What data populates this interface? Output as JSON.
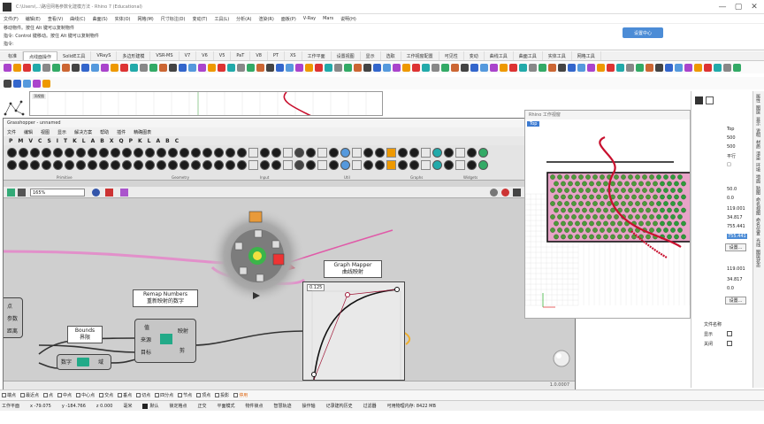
{
  "window": {
    "title": "C:\\Users\\...\\路径网格参数化建模方法 - Rhino 7 (Educational)",
    "controls": [
      "—",
      "▢",
      "✕"
    ]
  },
  "menu": [
    "文件(F)",
    "编辑(E)",
    "查看(V)",
    "曲线(C)",
    "曲面(S)",
    "实体(O)",
    "网格(M)",
    "尺寸标注(D)",
    "变动(T)",
    "工具(L)",
    "分析(A)",
    "渲染(R)",
    "面板(P)",
    "V-Ray",
    "Mars",
    "说明(H)"
  ],
  "command": {
    "line1": "移动物件。按住 Alt 键可以复制物件",
    "line2": "指令: Control 键移动。按住 Alt 键可以复制物件",
    "line3": "指令:",
    "button": "设置中心"
  },
  "tabs": [
    "标准",
    "点线面操作",
    "SolidE工具",
    "VRayS",
    "多边形建模",
    "VSR-MS",
    "V7",
    "V6",
    "V5",
    "PaT",
    "V8",
    "PT",
    "XS",
    "工作平面",
    "设置视图",
    "显示",
    "选取",
    "工作视窗配置",
    "可见性",
    "变动",
    "曲线工具",
    "曲面工具",
    "实体工具",
    "网格工具"
  ],
  "viewport_top": {
    "label": "顶视图"
  },
  "gh": {
    "title": "Grasshopper - unnamed",
    "menu": [
      "文件",
      "编辑",
      "视图",
      "显示",
      "解决方案",
      "帮助",
      "插件",
      "精确图表"
    ],
    "tabs": [
      "P",
      "M",
      "V",
      "C",
      "S",
      "I",
      "T",
      "K",
      "L",
      "A",
      "B",
      "X",
      "Q",
      "P",
      "K",
      "L",
      "A",
      "B",
      "C"
    ],
    "groups": [
      "Primitive",
      "Geometry",
      "Input",
      "Util",
      "Graphs",
      "Widgets"
    ],
    "zoom": "165%",
    "version": "1.0.0007",
    "components": {
      "point_labels": [
        "点",
        "参数",
        "距离"
      ],
      "bounds": {
        "title": "Bounds",
        "subtitle": "界限"
      },
      "numbers": {
        "title": "数字",
        "out": "域"
      },
      "remap": {
        "title": "Remap Numbers",
        "subtitle": "重新映射的数字",
        "inputs": [
          "值",
          "来源",
          "目标"
        ],
        "outputs": [
          "映射",
          "剪"
        ]
      },
      "graph_mapper": {
        "title": "Graph Mapper",
        "subtitle": "曲线映射",
        "value": "0.125"
      }
    }
  },
  "float_view": {
    "title": "Rhino 工作视窗",
    "tag": "Top"
  },
  "right_panel": {
    "values_top": [
      "Top",
      "500",
      "500",
      "平行",
      "□"
    ],
    "values_mid": [
      "50.0",
      "0.0",
      "119.001",
      "34.817",
      "755.441",
      "755.441"
    ],
    "btn1": "设置...",
    "values_low": [
      "119.001",
      "34.817",
      "0.0"
    ],
    "btn2": "设置...",
    "labels": [
      "文件名称",
      "显示",
      "关闭"
    ]
  },
  "vtabs": [
    "属性",
    "图层",
    "显示",
    "说明",
    "材质",
    "渲染",
    "环境",
    "地面",
    "贴图",
    "命名视图",
    "命名位置",
    "光线",
    "图层状态"
  ],
  "osnap": [
    "端点",
    "最近点",
    "点",
    "中点",
    "中心点",
    "交点",
    "垂点",
    "切点",
    "四分点",
    "节点",
    "顶点",
    "投影",
    "停用"
  ],
  "status": {
    "plane": "工作平面",
    "x": "x -79.075",
    "y": "y -184.766",
    "z": "z 0.000",
    "unit": "毫米",
    "layer": "默认",
    "items": [
      "锁定格点",
      "正交",
      "平面模式",
      "物件锁点",
      "智慧轨迹",
      "操作轴",
      "记录建构历史",
      "过滤器",
      "可用物理内存: 8422 MB"
    ]
  },
  "colors": {
    "accent": "#4c8cd6",
    "pink": "#e05aa8",
    "red": "#d8143a",
    "green": "#3bb54a"
  }
}
